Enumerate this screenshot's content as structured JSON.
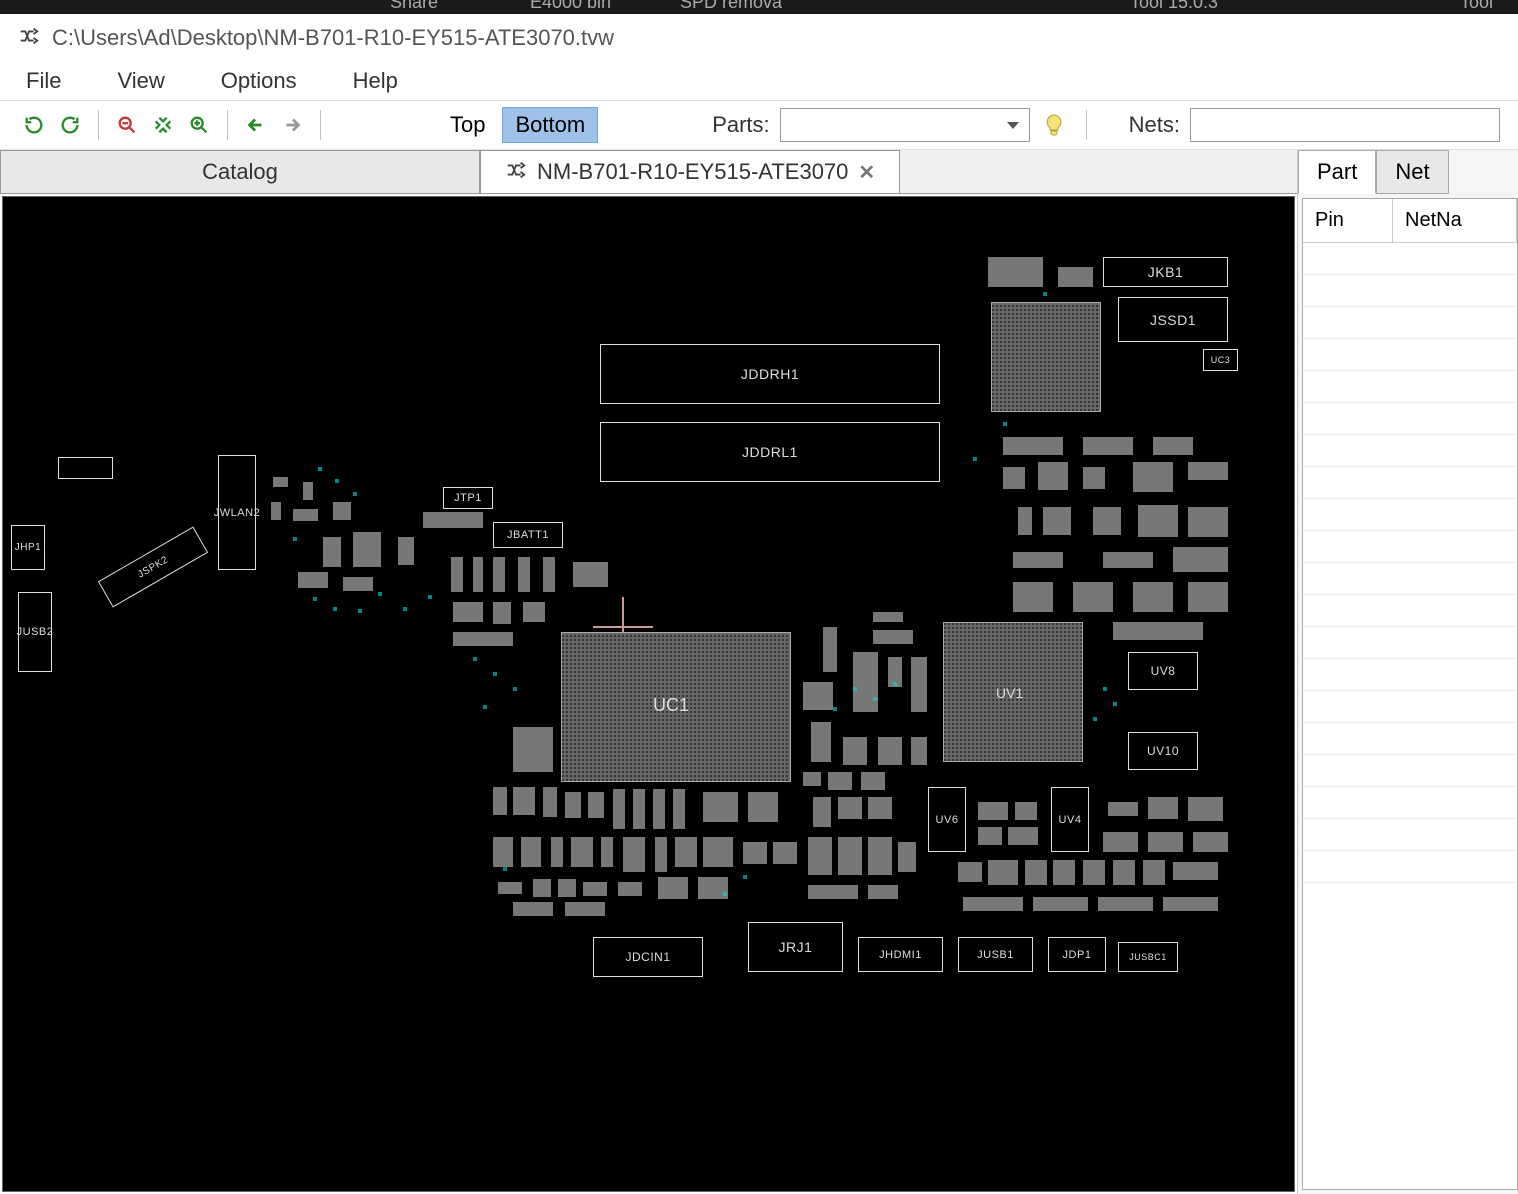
{
  "darktop": {
    "t1": "Share",
    "t2": "E4000 bin",
    "t3": "SPD remova",
    "t4": "Tool 15.0.3",
    "t5": "Tool"
  },
  "window": {
    "title": "C:\\Users\\Ad\\Desktop\\NM-B701-R10-EY515-ATE3070.tvw"
  },
  "menu": {
    "file": "File",
    "view": "View",
    "options": "Options",
    "help": "Help"
  },
  "toolbar": {
    "top": "Top",
    "bottom": "Bottom",
    "parts": "Parts:",
    "nets": "Nets:"
  },
  "tabs": {
    "catalog": "Catalog",
    "file": "NM-B701-R10-EY515-ATE3070"
  },
  "right": {
    "part": "Part",
    "net": "Net",
    "col_pin": "Pin",
    "col_netname": "NetNa"
  },
  "pcb": {
    "JKB1": "JKB1",
    "JSSD1": "JSSD1",
    "JDDRH1": "JDDRH1",
    "JDDRL1": "JDDRL1",
    "JWLAN2": "JWLAN2",
    "JTP1": "JTP1",
    "JBATT1": "JBATT1",
    "JUSB2": "JUSB2",
    "JHP1": "JHP1",
    "UC1": "UC1",
    "UV1": "UV1",
    "UV8": "UV8",
    "UV10": "UV10",
    "UV6": "UV6",
    "UV4": "UV4",
    "UC3": "UC3",
    "JDCIN1": "JDCIN1",
    "JRJ1": "JRJ1",
    "JHDMI1": "JHDMI1",
    "JUSB1": "JUSB1",
    "JDP1": "JDP1",
    "JUSBC1": "JUSBC1",
    "JSPK2": "JSPK2"
  }
}
